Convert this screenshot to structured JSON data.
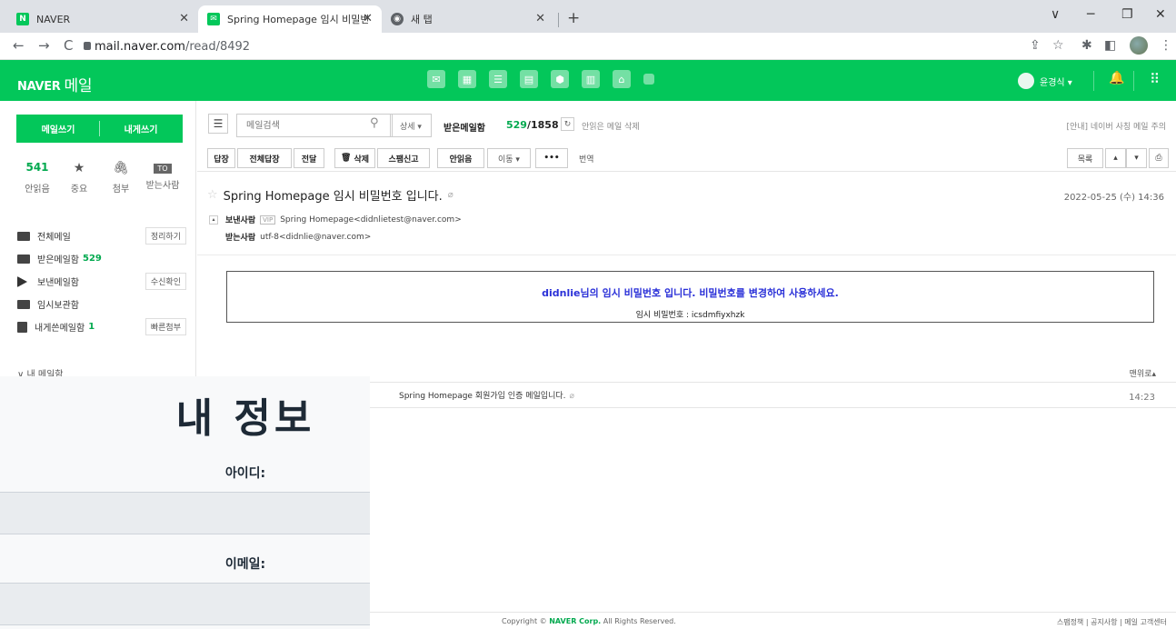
{
  "browser": {
    "tabs": [
      {
        "title": "NAVER"
      },
      {
        "title": "Spring Homepage 임시 비밀번..."
      },
      {
        "title": "새 탭"
      }
    ],
    "url_domain": "mail.naver.com",
    "url_path": "/read/8492"
  },
  "header": {
    "logo": "NAVER",
    "logo_sub": "메일",
    "user": "윤경식 ▾"
  },
  "sidebar": {
    "write_mail": "메일쓰기",
    "write_self": "내게쓰기",
    "stats": [
      {
        "value": "541",
        "label": "안읽음"
      },
      {
        "value": "",
        "label": "중요"
      },
      {
        "value": "",
        "label": "첨부"
      },
      {
        "value": "TO",
        "label": "받는사람"
      }
    ],
    "folders": [
      {
        "label": "전체메일",
        "count": "",
        "button": "정리하기"
      },
      {
        "label": "받은메일함",
        "count": "529",
        "button": ""
      },
      {
        "label": "보낸메일함",
        "count": "",
        "button": "수신확인"
      },
      {
        "label": "임시보관함",
        "count": "",
        "button": ""
      },
      {
        "label": "내게쓴메일함",
        "count": "1",
        "button": "빠른첨부"
      }
    ],
    "my_mailbox": "∨ 내 메일함"
  },
  "toolbar": {
    "search_placeholder": "메일검색",
    "detail": "상세 ▾",
    "inbox_label": "받은메일함",
    "inbox_unread": "529",
    "inbox_total": "/1858",
    "delete_unread": "안읽은 메일 삭제",
    "notice": "[안내] 네이버 사칭 메일 주의",
    "actions": [
      "답장",
      "전체답장",
      "전달",
      "삭제",
      "스팸신고",
      "안읽음",
      "이동 ▾",
      "•••"
    ],
    "translate": "번역",
    "list": "목록"
  },
  "mail": {
    "subject": "Spring Homepage 임시 비밀번호 입니다.",
    "date": "2022-05-25 (수) 14:36",
    "from_label": "보낸사람",
    "vip": "VIP",
    "from": "Spring Homepage<didnlietest@naver.com>",
    "to_label": "받는사람",
    "to": "utf-8<didnlie@naver.com>",
    "body_user": "didnlie",
    "body_text": "님의 임시 비밀번호 입니다. 비밀번호를 변경하여 사용하세요.",
    "body_password": "임시 비밀번호 : icsdmfiyxhzk",
    "to_top": "맨위로▴"
  },
  "prev_mail": {
    "subject": "Spring Homepage 회원가입 인증 메일입니다.",
    "time": "14:23"
  },
  "footer": {
    "copy_prefix": "Copyright © ",
    "copy_corp": "NAVER Corp.",
    "copy_suffix": " All Rights Reserved.",
    "links": "스팸정책 | 공지사항 | 메일 고객센터"
  },
  "overlay": {
    "title": "내 정보",
    "id_label": "아이디:",
    "email_label": "이메일:"
  }
}
